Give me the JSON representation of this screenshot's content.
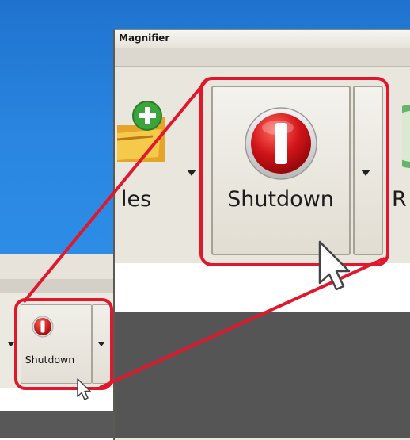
{
  "magnifier": {
    "title": "Magnifier",
    "left_partial_label": "les",
    "right_partial_label": "R",
    "big_button_label": "Shutdown"
  },
  "toolbar": {
    "small_button_label": "Shutdown"
  },
  "icons": {
    "shutdown": "shutdown-icon",
    "files": "folder-add-icon",
    "cursor": "mouse-pointer-icon"
  },
  "colors": {
    "callout": "#e0182d",
    "desktop": "#2a86e0",
    "shutdown_red": "#c50d12"
  }
}
